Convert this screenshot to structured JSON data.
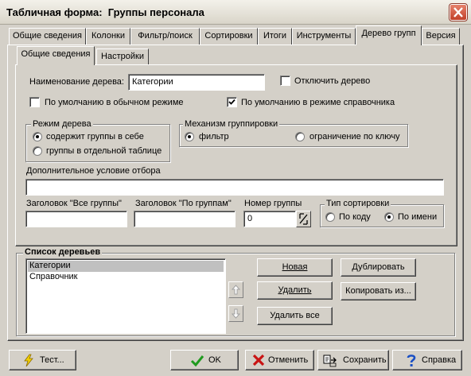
{
  "window": {
    "title": "Табличная форма:  Группы персонала",
    "close_icon": "close-icon"
  },
  "tabs": [
    {
      "label": "Общие сведения",
      "active": false
    },
    {
      "label": "Колонки",
      "active": false
    },
    {
      "label": "Фильтр/поиск",
      "active": false
    },
    {
      "label": "Сортировки",
      "active": false
    },
    {
      "label": "Итоги",
      "active": false
    },
    {
      "label": "Инструменты",
      "active": false
    },
    {
      "label": "Дерево групп",
      "active": true
    },
    {
      "label": "Версия",
      "active": false
    }
  ],
  "subtabs": [
    {
      "label": "Общие сведения",
      "active": true
    },
    {
      "label": "Настройки",
      "active": false
    }
  ],
  "tree_form": {
    "name_label": "Наименование дерева:",
    "name_value": "Категории",
    "disable_tree_label": "Отключить дерево",
    "disable_tree_checked": false,
    "default_normal_label": "По умолчанию в обычном режиме",
    "default_normal_checked": false,
    "default_ref_label": "По умолчанию в режиме справочника",
    "default_ref_checked": true,
    "mode_group_label": "Режим дерева",
    "mode_options": [
      "содержит группы в себе",
      "группы в отдельной таблице"
    ],
    "mode_selected": 0,
    "mech_group_label": "Механизм группировки",
    "mech_options": [
      "фильтр",
      "ограничение по ключу"
    ],
    "mech_selected": 0,
    "extra_cond_label": "Дополнительное условие отбора",
    "extra_cond_value": "",
    "all_groups_label": "Заголовок \"Все группы\"",
    "all_groups_value": "",
    "by_groups_label": "Заголовок \"По группам\"",
    "by_groups_value": "",
    "group_num_label": "Номер группы",
    "group_num_value": "0",
    "sort_group_label": "Тип сортировки",
    "sort_options": [
      "По коду",
      "По имени"
    ],
    "sort_selected": 1
  },
  "tree_list": {
    "label": "Список деревьев",
    "items": [
      "Категории",
      "Справочник"
    ],
    "selected": 0,
    "up_icon": "arrow-up-icon",
    "down_icon": "arrow-down-icon",
    "new_button": "Новая",
    "delete_button": "Удалить",
    "delete_all_button": "Удалить все",
    "duplicate_button": "Дублировать",
    "copy_from_button": "Копировать из..."
  },
  "footer": {
    "test_button": "Тест...",
    "ok_button": "OK",
    "cancel_button": "Отменить",
    "save_button": "Сохранить",
    "help_button": "Справка",
    "icons": {
      "test": "lightning-icon",
      "ok": "checkmark-icon",
      "cancel": "x-icon",
      "save": "save-icon",
      "help": "help-icon"
    },
    "colors": {
      "ok": "#1f9a1f",
      "cancel": "#c81414",
      "help": "#1a4fc4",
      "test": "#f2d000"
    }
  }
}
